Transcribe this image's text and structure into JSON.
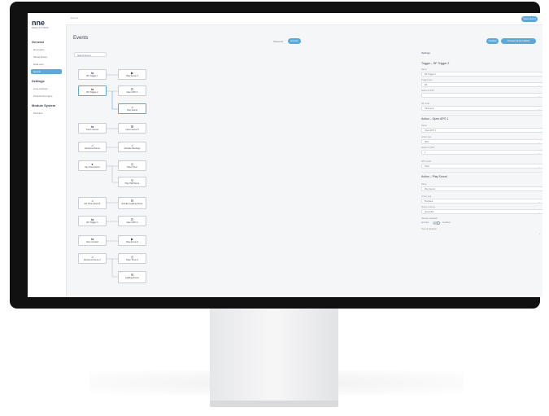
{
  "sidebar": {
    "logo": "nne",
    "logo_sub": "MEDIA SYSTEMS",
    "sections": [
      {
        "label": "General",
        "items": [
          "Ex-project",
          "Model library",
          "Data sets",
          "Events"
        ]
      },
      {
        "label": "Settings",
        "items": [
          "Area settings",
          "Peripheral engine"
        ]
      },
      {
        "label": "Module System",
        "items": [
          "Modules"
        ]
      }
    ],
    "active_item": "Events"
  },
  "topbar": {
    "breadcrumb": "Events",
    "button_label": "Save Event"
  },
  "page": {
    "title": "Events",
    "toggle_label": "Sessions",
    "toggle_pill": "Events",
    "action1": "Publish",
    "action2": "Preview Event Editor"
  },
  "canvas": {
    "filter_label": "Select Event",
    "nodes": [
      {
        "num": "1",
        "icon": "⇆",
        "label": "RF Trigger 1"
      },
      {
        "num": "1",
        "icon": "▶",
        "label": "Play Scene 4"
      },
      {
        "num": "2",
        "icon": "⇆",
        "label": "RF Trigger 2"
      },
      {
        "num": "2",
        "icon": "⊡",
        "label": "Open APO 1"
      },
      {
        "num": "3",
        "icon": "♫",
        "label": "Play Sound"
      },
      {
        "num": "3",
        "icon": "⇆",
        "label": "Touch Sensor"
      },
      {
        "num": "3",
        "icon": "⊞",
        "label": "Open Scene 5"
      },
      {
        "num": "4",
        "icon": "♫",
        "label": "Ext Event Scene"
      },
      {
        "num": "4",
        "icon": "♫",
        "label": "Activate Message"
      },
      {
        "num": "5",
        "icon": "●",
        "label": "Key Press Event"
      },
      {
        "num": "5",
        "icon": "◷",
        "label": "Open Timer"
      },
      {
        "num": "6",
        "icon": "⚲",
        "label": "Play Hall Scene"
      },
      {
        "num": "6",
        "icon": "♫",
        "label": "Ext Timer Event A"
      },
      {
        "num": "6",
        "icon": "⊟",
        "label": "Activate Lighting Scene"
      },
      {
        "num": "7",
        "icon": "⇆",
        "label": "RF Trigger 3"
      },
      {
        "num": "7",
        "icon": "⊡",
        "label": "Open APO 2"
      },
      {
        "num": "8",
        "icon": "⇆",
        "label": "Door Contact"
      },
      {
        "num": "8",
        "icon": "▶",
        "label": "Play Scene 6"
      },
      {
        "num": "9",
        "icon": "♫",
        "label": "Ext Event Scene 2"
      },
      {
        "num": "9",
        "icon": "◷",
        "label": "Open Timer 2"
      },
      {
        "num": "10",
        "icon": "⊟",
        "label": "Lighting Scene"
      }
    ]
  },
  "properties": {
    "tab": "Settings",
    "trigger_title": "Trigger – RF Trigger 2",
    "trigger_fields": [
      {
        "label": "Name",
        "value": "RF Trigger 2",
        "dropdown": false
      },
      {
        "label": "Trigger type",
        "value": "RF",
        "dropdown": true
      },
      {
        "label": "Select an RFT",
        "value": "",
        "dropdown": true
      },
      {
        "label": "RF mode",
        "value": "Channel A",
        "dropdown": true
      }
    ],
    "action1_title": "Action – Open APO 1",
    "action1_fields": [
      {
        "label": "Name",
        "value": "Open APO 1",
        "dropdown": false
      },
      {
        "label": "Action type",
        "value": "APO",
        "dropdown": true
      },
      {
        "label": "Select an APO",
        "value": "1",
        "dropdown": true
      },
      {
        "label": "APO mode",
        "value": "Open",
        "dropdown": true
      }
    ],
    "action2_title": "Action – Play Sound",
    "action2_fields": [
      {
        "label": "Name",
        "value": "Play Sound",
        "dropdown": false
      },
      {
        "label": "Action type",
        "value": "Playback",
        "dropdown": true
      },
      {
        "label": "Select a source",
        "value": "Sound file",
        "dropdown": true
      }
    ],
    "random_label": "Random playback",
    "random_state": "Enabled",
    "random_off": "Disabled",
    "type_label": "Type of playback"
  }
}
